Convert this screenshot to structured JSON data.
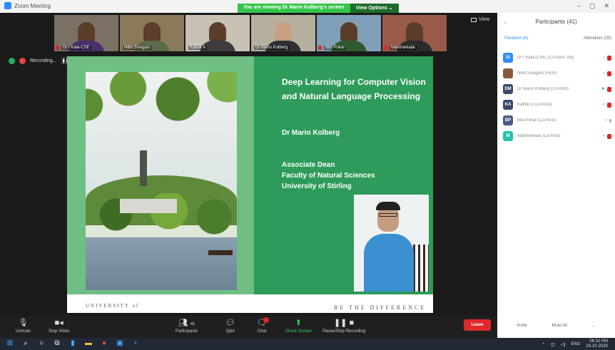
{
  "window": {
    "app_name": "Zoom Meeting",
    "share_banner": "You are viewing Dr Mario Kolberg's screen",
    "view_options": "View Options ⌄",
    "controls": [
      "–",
      "▢",
      "✕"
    ]
  },
  "gallery": [
    {
      "name": "Dr I Kala-CSE",
      "muted": true
    },
    {
      "name": "Nithi Sivaguru",
      "muted": false
    },
    {
      "name": "Kathik A",
      "muted": false
    },
    {
      "name": "Dr Mario Kolberg",
      "muted": false
    },
    {
      "name": "Bibi Pokar",
      "muted": true
    },
    {
      "name": "Manimekalai",
      "muted": true
    }
  ],
  "view_button": "View",
  "recording": {
    "label": "Recording..."
  },
  "slide": {
    "title": "Deep Learning for Computer Vision and Natural Language Processing",
    "author": "Dr Mario Kolberg",
    "role_line1": "Associate Dean",
    "role_line2": "Faculty of Natural Sciences",
    "role_line3": "University of Stirling",
    "footer_left": "UNIVERSITY of",
    "footer_right": "BE THE DIFFERENCE"
  },
  "panel": {
    "title": "Participants (41)",
    "tab_panelists": "Panelists (6)",
    "tab_attendees": "Attendees (35)",
    "participants": [
      {
        "initials": "DI",
        "name": "Dr I Kala (CSE) (Co-host, me)",
        "color": "#2d8cff"
      },
      {
        "initials": "",
        "name": "Nithi Sivaguru (Host)",
        "color": "#8a5a3c"
      },
      {
        "initials": "DM",
        "name": "Dr Mario Kolberg (Co-host)",
        "color": "#3b4a6b"
      },
      {
        "initials": "KA",
        "name": "Kathik A (Co-host)",
        "color": "#3b4a6b"
      },
      {
        "initials": "BP",
        "name": "Bibi Pokar (Co-host)",
        "color": "#4a5a8a"
      },
      {
        "initials": "M",
        "name": "Manimekalai (Co-host)",
        "color": "#29c1b0"
      }
    ],
    "footer_invite": "Invite",
    "footer_mute_all": "Mute All",
    "footer_more": "..."
  },
  "toolbar": {
    "unmute": "Unmute",
    "stop_video": "Stop Video",
    "participants": "Participants",
    "participants_count": "41",
    "qa": "Q&A",
    "chat": "Chat",
    "share_screen": "Share Screen",
    "pause_recording": "Pause/Stop Recording",
    "leave": "Leave"
  },
  "taskbar": {
    "language": "ENG",
    "time": "06:32 PM",
    "date": "29-10-2020"
  },
  "colors": {
    "slide_green": "#2e9b5a",
    "slide_light_green": "#6fbf85",
    "share_banner_green": "#34c54a",
    "leave_red": "#e0292a",
    "zoom_blue": "#2d8cff"
  }
}
